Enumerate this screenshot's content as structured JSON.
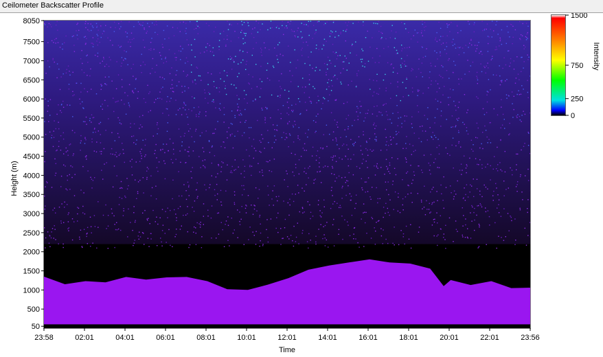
{
  "window": {
    "title": "Ceilometer Backscatter Profile"
  },
  "chart_data": {
    "type": "heatmap",
    "xlabel": "Time",
    "ylabel": "Height (m)",
    "x_tick_labels": [
      "23:58",
      "02:01",
      "04:01",
      "06:01",
      "08:01",
      "10:01",
      "12:01",
      "14:01",
      "16:01",
      "18:01",
      "20:01",
      "22:01",
      "23:56"
    ],
    "y_ticks": [
      50,
      500,
      1000,
      1500,
      2000,
      2500,
      3000,
      3500,
      4000,
      4500,
      5000,
      5500,
      6000,
      6500,
      7000,
      7500,
      8050
    ],
    "ylim": [
      0,
      8050
    ],
    "colorbar": {
      "label": "Intensity",
      "ticks": [
        {
          "value": 1500,
          "label": "1500"
        },
        {
          "value": 750,
          "label": "750"
        },
        {
          "value": 250,
          "label": "250"
        },
        {
          "value": 0,
          "label": "0"
        }
      ],
      "range": [
        0,
        1500
      ]
    },
    "boundary_layer_top_m": [
      {
        "time": "23:58",
        "height": 1350
      },
      {
        "time": "01:00",
        "height": 1150
      },
      {
        "time": "02:01",
        "height": 1230
      },
      {
        "time": "03:00",
        "height": 1200
      },
      {
        "time": "04:01",
        "height": 1340
      },
      {
        "time": "05:00",
        "height": 1270
      },
      {
        "time": "06:01",
        "height": 1330
      },
      {
        "time": "07:00",
        "height": 1340
      },
      {
        "time": "08:01",
        "height": 1230
      },
      {
        "time": "09:00",
        "height": 1020
      },
      {
        "time": "10:01",
        "height": 1000
      },
      {
        "time": "11:00",
        "height": 1140
      },
      {
        "time": "12:01",
        "height": 1310
      },
      {
        "time": "13:00",
        "height": 1530
      },
      {
        "time": "14:01",
        "height": 1640
      },
      {
        "time": "15:00",
        "height": 1720
      },
      {
        "time": "16:01",
        "height": 1800
      },
      {
        "time": "17:00",
        "height": 1720
      },
      {
        "time": "18:01",
        "height": 1690
      },
      {
        "time": "19:00",
        "height": 1560
      },
      {
        "time": "19:40",
        "height": 1100
      },
      {
        "time": "20:01",
        "height": 1260
      },
      {
        "time": "21:00",
        "height": 1130
      },
      {
        "time": "22:01",
        "height": 1230
      },
      {
        "time": "23:00",
        "height": 1050
      },
      {
        "time": "23:56",
        "height": 1060
      }
    ],
    "layers": [
      {
        "from_m": 0,
        "to_m": 100,
        "intensity": "saturated-floor"
      },
      {
        "from_m": 100,
        "to_m": "boundary_layer_top",
        "intensity": "high (purple)"
      },
      {
        "from_m": "boundary_layer_top",
        "to_m": 2200,
        "intensity": "clear (black)"
      },
      {
        "from_m": 2200,
        "to_m": 8050,
        "intensity": "noise, increasing blue toward top"
      }
    ],
    "grid": false
  },
  "colors": {
    "colorbar_stops": [
      "#000000",
      "#0000ff",
      "#00e0e0",
      "#00ff00",
      "#ffff00",
      "#ff8000",
      "#ff0000",
      "#ffffff"
    ],
    "aerosol_layer": "#9a16f0",
    "background": "#000000"
  }
}
